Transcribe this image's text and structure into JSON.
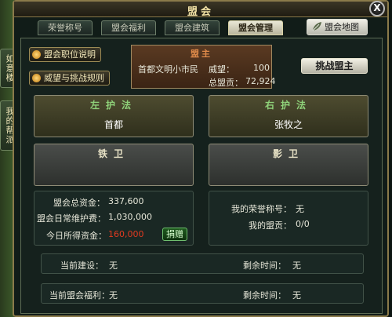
{
  "side_tabs": [
    "如意楼",
    "我的帮派"
  ],
  "window": {
    "title": "盟会",
    "close": "X"
  },
  "tabs": [
    {
      "label": "荣誉称号",
      "active": false
    },
    {
      "label": "盟会福利",
      "active": false
    },
    {
      "label": "盟会建筑",
      "active": false
    },
    {
      "label": "盟会管理",
      "active": true
    }
  ],
  "map_button": "盟会地图",
  "info_buttons": {
    "position_desc": "盟会职位说明",
    "prestige_rules": "威望与挑战规则"
  },
  "leader": {
    "title": "盟主",
    "name": "首都文明小市民",
    "prestige_label": "威望：",
    "prestige_value": "100",
    "contribution_label": "总盟贡：",
    "contribution_value": "72,924"
  },
  "challenge_button": "挑战盟主",
  "guards": {
    "left_protector": {
      "title": "左护法",
      "name": "首都"
    },
    "right_protector": {
      "title": "右护法",
      "name": "张牧之"
    },
    "iron_guard": {
      "title": "铁卫",
      "name": ""
    },
    "shadow_guard": {
      "title": "影卫",
      "name": ""
    }
  },
  "funds": {
    "total_label": "盟会总资金：",
    "total_value": "337,600",
    "maintenance_label": "盟会日常维护费：",
    "maintenance_value": "1,030,000",
    "today_label": "今日所得资金：",
    "today_value": "160,000",
    "donate_button": "捐赠"
  },
  "my_info": {
    "title_label": "我的荣誉称号：",
    "title_value": "无",
    "contrib_label": "我的盟贡：",
    "contrib_value": "0/0"
  },
  "construction": {
    "label": "当前建设：",
    "value": "无",
    "time_label": "剩余时间：",
    "time_value": "无"
  },
  "welfare": {
    "label": "当前盟会福利：",
    "value": "无",
    "time_label": "剩余时间：",
    "time_value": "无"
  }
}
